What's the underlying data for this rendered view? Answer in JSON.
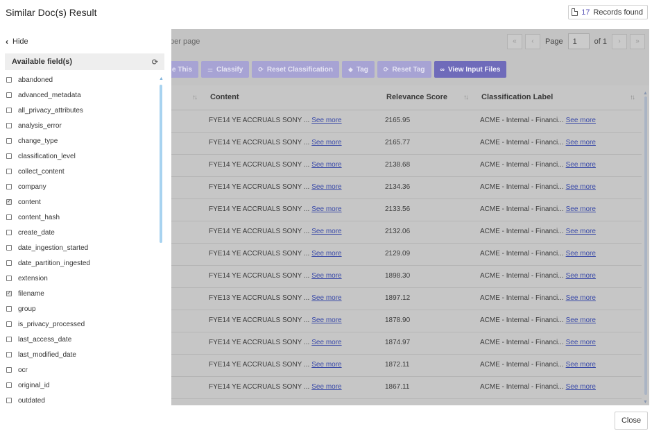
{
  "header": {
    "title": "Similar Doc(s) Result",
    "records_count": "17",
    "records_label": "Records found"
  },
  "panel": {
    "hide_label": "Hide",
    "fields_title": "Available field(s)",
    "fields": [
      {
        "name": "abandoned",
        "checked": false
      },
      {
        "name": "advanced_metadata",
        "checked": false
      },
      {
        "name": "all_privacy_attributes",
        "checked": false
      },
      {
        "name": "analysis_error",
        "checked": false
      },
      {
        "name": "change_type",
        "checked": false
      },
      {
        "name": "classification_level",
        "checked": false
      },
      {
        "name": "collect_content",
        "checked": false
      },
      {
        "name": "company",
        "checked": false
      },
      {
        "name": "content",
        "checked": true
      },
      {
        "name": "content_hash",
        "checked": false
      },
      {
        "name": "create_date",
        "checked": false
      },
      {
        "name": "date_ingestion_started",
        "checked": false
      },
      {
        "name": "date_partition_ingested",
        "checked": false
      },
      {
        "name": "extension",
        "checked": false
      },
      {
        "name": "filename",
        "checked": true
      },
      {
        "name": "group",
        "checked": false
      },
      {
        "name": "is_privacy_processed",
        "checked": false
      },
      {
        "name": "last_access_date",
        "checked": false
      },
      {
        "name": "last_modified_date",
        "checked": false
      },
      {
        "name": "ocr",
        "checked": false
      },
      {
        "name": "original_id",
        "checked": false
      },
      {
        "name": "outdated",
        "checked": false
      }
    ]
  },
  "main": {
    "per_page_text": "per page",
    "pager": {
      "first": "«",
      "prev": "‹",
      "page_label": "Page",
      "page_value": "1",
      "of_label": "of 1",
      "next": "›",
      "last": "»"
    },
    "toolbar": [
      {
        "label": "e This",
        "icon": "",
        "style": "light"
      },
      {
        "label": "Classify",
        "icon": "sitemap-icon",
        "style": "light"
      },
      {
        "label": "Reset Classification",
        "icon": "refresh-icon",
        "style": "light"
      },
      {
        "label": "Tag",
        "icon": "tag-icon",
        "style": "light"
      },
      {
        "label": "Reset Tag",
        "icon": "refresh-icon",
        "style": "light"
      },
      {
        "label": "View Input Files",
        "icon": "binoculars-icon",
        "style": "dark"
      }
    ],
    "columns": {
      "content": "Content",
      "relevance": "Relevance Score",
      "classification": "Classification Label"
    },
    "see_more": "See more",
    "rows": [
      {
        "content": "FYE14 YE ACCRUALS SONY ...",
        "score": "2165.95",
        "label": "ACME - Internal - Financi..."
      },
      {
        "content": "FYE14 YE ACCRUALS SONY ...",
        "score": "2165.77",
        "label": "ACME - Internal - Financi..."
      },
      {
        "content": "FYE14 YE ACCRUALS SONY ...",
        "score": "2138.68",
        "label": "ACME - Internal - Financi..."
      },
      {
        "content": "FYE14 YE ACCRUALS SONY ...",
        "score": "2134.36",
        "label": "ACME - Internal - Financi..."
      },
      {
        "content": "FYE14 YE ACCRUALS SONY ...",
        "score": "2133.56",
        "label": "ACME - Internal - Financi..."
      },
      {
        "content": "FYE14 YE ACCRUALS SONY ...",
        "score": "2132.06",
        "label": "ACME - Internal - Financi..."
      },
      {
        "content": "FYE14 YE ACCRUALS SONY ...",
        "score": "2129.09",
        "label": "ACME - Internal - Financi..."
      },
      {
        "content": "FYE14 YE ACCRUALS SONY ...",
        "score": "1898.30",
        "label": "ACME - Internal - Financi..."
      },
      {
        "content": "FYE13 YE ACCRUALS SONY ...",
        "score": "1897.12",
        "label": "ACME - Internal - Financi..."
      },
      {
        "content": "FYE14 YE ACCRUALS SONY ...",
        "score": "1878.90",
        "label": "ACME - Internal - Financi..."
      },
      {
        "content": "FYE14 YE ACCRUALS SONY ...",
        "score": "1874.97",
        "label": "ACME - Internal - Financi..."
      },
      {
        "content": "FYE14 YE ACCRUALS SONY ...",
        "score": "1872.11",
        "label": "ACME - Internal - Financi..."
      },
      {
        "content": "FYE14 YE ACCRUALS SONY ...",
        "score": "1867.11",
        "label": "ACME - Internal - Financi..."
      }
    ]
  },
  "footer": {
    "close_label": "Close"
  }
}
